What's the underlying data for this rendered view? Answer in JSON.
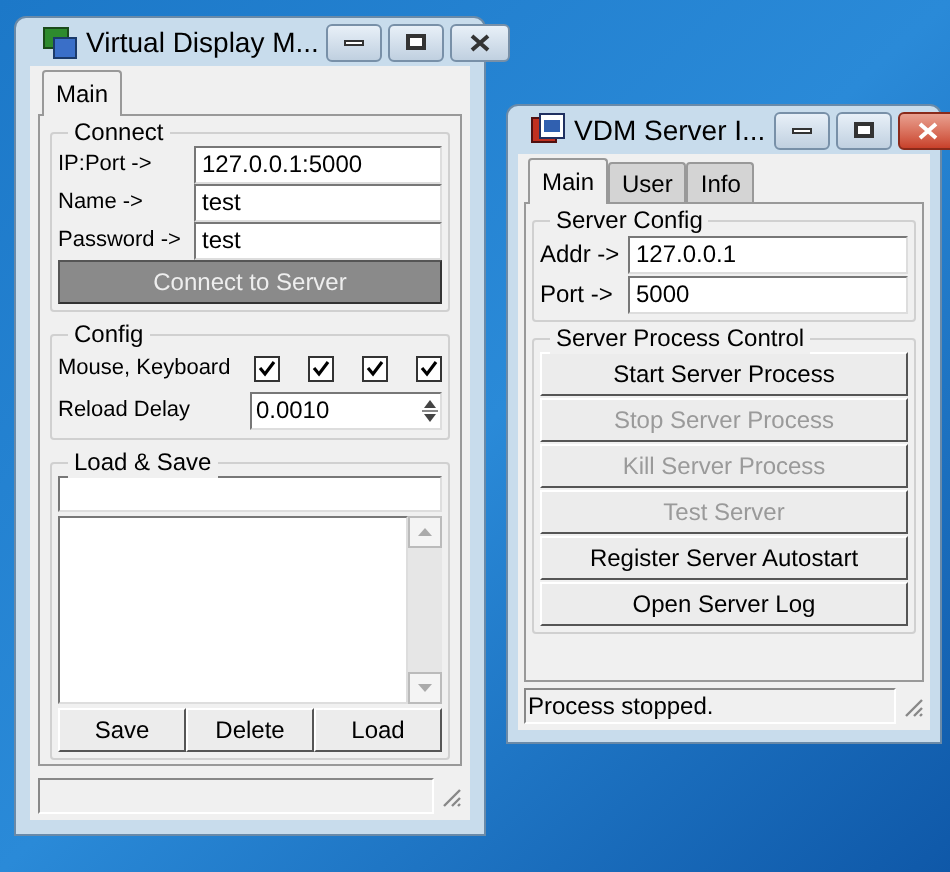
{
  "client": {
    "title": "Virtual Display M...",
    "active": false,
    "tabs": [
      {
        "label": "Main",
        "selected": true
      }
    ],
    "connect": {
      "title": "Connect",
      "fields": [
        {
          "label": "IP:Port ->",
          "value": "127.0.0.1:5000"
        },
        {
          "label": "Name ->",
          "value": "test"
        },
        {
          "label": "Password ->",
          "value": "test"
        }
      ],
      "button": {
        "label": "Connect to Server",
        "pressed": true
      }
    },
    "config": {
      "title": "Config",
      "input_label": "Mouse, Keyboard",
      "checkboxes": [
        {
          "checked": true
        },
        {
          "checked": true
        },
        {
          "checked": true
        },
        {
          "checked": true
        }
      ],
      "delay_label": "Reload Delay",
      "delay_value": "0.0010"
    },
    "load_save": {
      "title": "Load & Save",
      "buttons": [
        "Save",
        "Delete",
        "Load"
      ]
    }
  },
  "server": {
    "title": "VDM Server I...",
    "active": true,
    "tabs": [
      {
        "label": "Main",
        "selected": true
      },
      {
        "label": "User",
        "selected": false
      },
      {
        "label": "Info",
        "selected": false
      }
    ],
    "config": {
      "title": "Server Config",
      "fields": [
        {
          "label": "Addr ->",
          "value": "127.0.0.1"
        },
        {
          "label": "Port ->",
          "value": "5000"
        }
      ]
    },
    "control": {
      "title": "Server Process Control",
      "buttons": [
        {
          "label": "Start Server Process",
          "disabled": false
        },
        {
          "label": "Stop Server Process",
          "disabled": true
        },
        {
          "label": "Kill Server Process",
          "disabled": true
        },
        {
          "label": "Test Server",
          "disabled": true
        },
        {
          "label": "Register Server Autostart",
          "disabled": false
        },
        {
          "label": "Open Server Log",
          "disabled": false
        }
      ]
    },
    "status": "Process stopped."
  }
}
